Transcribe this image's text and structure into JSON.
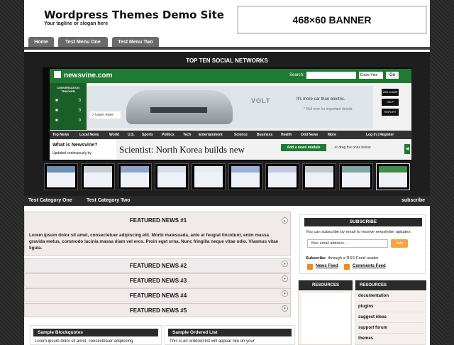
{
  "site": {
    "title": "Wordpress Themes Demo Site",
    "tagline": "Your tagline or slogan here",
    "banner": "468×60 BANNER"
  },
  "nav": {
    "tabs": [
      "Home",
      "Test Menu One",
      "Test Menu Two"
    ]
  },
  "featured_gallery": {
    "title": "TOP TEN SOCIAL NETWORKS",
    "slide": {
      "logo": "newsvine.com",
      "search_label": "Search:",
      "search_select": "Entire Vine",
      "go": "Go",
      "conversation_tracker": "CONVERSATION TRACKER",
      "stats": [
        "0",
        "0",
        "0"
      ],
      "learn_more": "> Learn more",
      "ad_brand": "VOLT",
      "ad_text": "It's more car than electric.",
      "ad_sub": "* Roll over for important details.",
      "right_buttons": [
        "WELCOME",
        "HELP",
        "REPORT BUG"
      ],
      "menu": [
        "Top News",
        "Local News",
        "World",
        "U.S.",
        "Sports",
        "Politics",
        "Tech",
        "Entertainment",
        "Science",
        "Business",
        "Health",
        "Odd News",
        "More",
        "Log In | Register"
      ],
      "what_heading": "What is Newsvine?",
      "what_text": "Updated continuously by",
      "headline": "Scientist: North Korea builds new",
      "add_module": "Add a news module",
      "drag_text": "... or drag the ones below"
    },
    "thumb_colors": [
      "#6f8fb0",
      "#c9ccd0",
      "#8fa4c8",
      "#d7dde8",
      "#e7ebf2",
      "#9fb0d6",
      "#c5c8e0",
      "#bfc9cc",
      "#7fa6a0",
      "#3d8a4a"
    ],
    "selected_thumb": 9
  },
  "categories": {
    "items": [
      "Test Category One",
      "Test Category Two"
    ],
    "subscribe": "subscribe"
  },
  "featured_news": [
    {
      "title": "FEATURED NEWS #1",
      "toggle": "▴",
      "body": "Lorem ipsum dolor sit amet, consectetuer adipiscing elit. Morbi malesuada, ante at feugiat tincidunt, enim massa gravida metus, commodo lacinia massa diam vel eros. Proin eget urna. Nunc fringilla neque vitae odio. Vivamus vitae ligula."
    },
    {
      "title": "FEATURED NEWS #2",
      "toggle": "▾"
    },
    {
      "title": "FEATURED NEWS #3",
      "toggle": "▾"
    },
    {
      "title": "FEATURED NEWS #4",
      "toggle": "▾"
    },
    {
      "title": "FEATURED NEWS #5",
      "toggle": "▾"
    }
  ],
  "blockquotes": {
    "title": "Sample Blockquotes",
    "text": "Lorem ipsum dolor sit amet, consectetuer adipiscing"
  },
  "ordered_list": {
    "title": "Sample Ordered List",
    "text": "This is an ordered list will appear like on your"
  },
  "subscribe_box": {
    "title": "SUBSCRIBE",
    "text": "You can subscribe by email to receive newsletter updates:",
    "input_value": "Your email address ...",
    "button": "Join",
    "rss_intro_bold": "Subscribe",
    "rss_intro": "through a RSS Feed reader",
    "news_feed": "News Feed",
    "comments_feed": "Comments Feed"
  },
  "resources_left": {
    "title": "RESOURCES"
  },
  "resources_right": {
    "title": "RESOURCES",
    "items": [
      "documentation",
      "plugins",
      "suggest ideas",
      "support forum",
      "themes"
    ]
  }
}
